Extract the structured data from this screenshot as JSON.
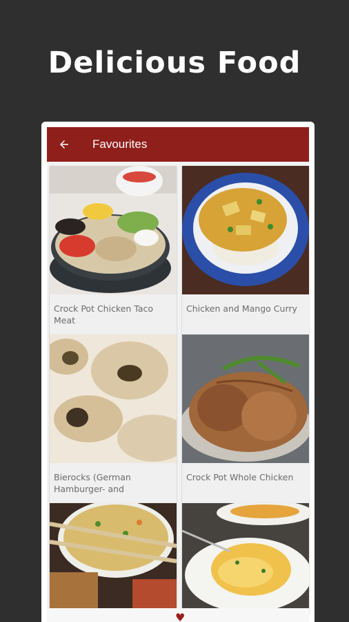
{
  "hero": {
    "title": "Delicious Food"
  },
  "appbar": {
    "title": "Favourites",
    "back_icon": "arrow-left-icon"
  },
  "recipes": [
    {
      "title": "Crock Pot Chicken Taco Meat"
    },
    {
      "title": "Chicken and Mango Curry"
    },
    {
      "title": "Bierocks (German Hamburger- and"
    },
    {
      "title": "Crock Pot Whole Chicken"
    },
    {
      "title": ""
    },
    {
      "title": ""
    }
  ],
  "bottom_nav": {
    "favourites_icon": "heart-icon"
  },
  "colors": {
    "background": "#2f2f2f",
    "appbar": "#8f1f1b",
    "accent": "#9a1f1b"
  }
}
